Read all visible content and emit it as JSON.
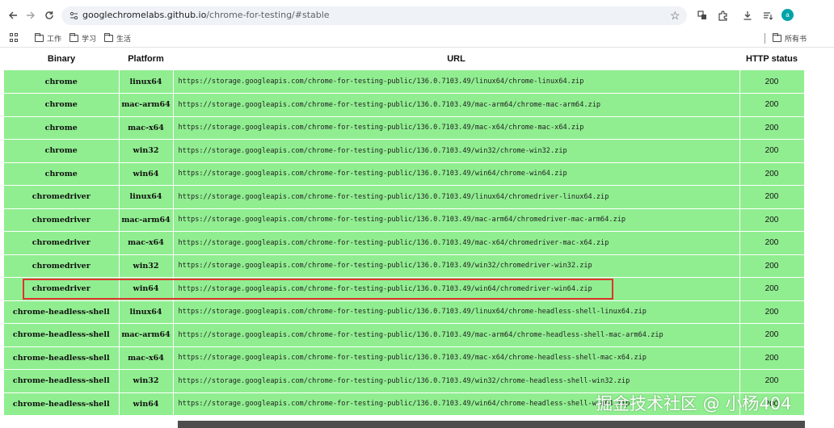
{
  "browser": {
    "url_host": "googlechromelabs.github.io",
    "url_path": "/chrome-for-testing/#stable",
    "avatar_letter": "a"
  },
  "bookmarks": {
    "items": [
      {
        "label": "工作"
      },
      {
        "label": "学习"
      },
      {
        "label": "生活"
      }
    ],
    "all_bookmarks_label": "所有书"
  },
  "table": {
    "headers": {
      "binary": "Binary",
      "platform": "Platform",
      "url": "URL",
      "status": "HTTP status"
    },
    "rows": [
      {
        "binary": "chrome",
        "platform": "linux64",
        "url": "https://storage.googleapis.com/chrome-for-testing-public/136.0.7103.49/linux64/chrome-linux64.zip",
        "status": "200"
      },
      {
        "binary": "chrome",
        "platform": "mac-arm64",
        "url": "https://storage.googleapis.com/chrome-for-testing-public/136.0.7103.49/mac-arm64/chrome-mac-arm64.zip",
        "status": "200"
      },
      {
        "binary": "chrome",
        "platform": "mac-x64",
        "url": "https://storage.googleapis.com/chrome-for-testing-public/136.0.7103.49/mac-x64/chrome-mac-x64.zip",
        "status": "200"
      },
      {
        "binary": "chrome",
        "platform": "win32",
        "url": "https://storage.googleapis.com/chrome-for-testing-public/136.0.7103.49/win32/chrome-win32.zip",
        "status": "200"
      },
      {
        "binary": "chrome",
        "platform": "win64",
        "url": "https://storage.googleapis.com/chrome-for-testing-public/136.0.7103.49/win64/chrome-win64.zip",
        "status": "200"
      },
      {
        "binary": "chromedriver",
        "platform": "linux64",
        "url": "https://storage.googleapis.com/chrome-for-testing-public/136.0.7103.49/linux64/chromedriver-linux64.zip",
        "status": "200"
      },
      {
        "binary": "chromedriver",
        "platform": "mac-arm64",
        "url": "https://storage.googleapis.com/chrome-for-testing-public/136.0.7103.49/mac-arm64/chromedriver-mac-arm64.zip",
        "status": "200"
      },
      {
        "binary": "chromedriver",
        "platform": "mac-x64",
        "url": "https://storage.googleapis.com/chrome-for-testing-public/136.0.7103.49/mac-x64/chromedriver-mac-x64.zip",
        "status": "200"
      },
      {
        "binary": "chromedriver",
        "platform": "win32",
        "url": "https://storage.googleapis.com/chrome-for-testing-public/136.0.7103.49/win32/chromedriver-win32.zip",
        "status": "200"
      },
      {
        "binary": "chromedriver",
        "platform": "win64",
        "url": "https://storage.googleapis.com/chrome-for-testing-public/136.0.7103.49/win64/chromedriver-win64.zip",
        "status": "200"
      },
      {
        "binary": "chrome-headless-shell",
        "platform": "linux64",
        "url": "https://storage.googleapis.com/chrome-for-testing-public/136.0.7103.49/linux64/chrome-headless-shell-linux64.zip",
        "status": "200"
      },
      {
        "binary": "chrome-headless-shell",
        "platform": "mac-arm64",
        "url": "https://storage.googleapis.com/chrome-for-testing-public/136.0.7103.49/mac-arm64/chrome-headless-shell-mac-arm64.zip",
        "status": "200"
      },
      {
        "binary": "chrome-headless-shell",
        "platform": "mac-x64",
        "url": "https://storage.googleapis.com/chrome-for-testing-public/136.0.7103.49/mac-x64/chrome-headless-shell-mac-x64.zip",
        "status": "200"
      },
      {
        "binary": "chrome-headless-shell",
        "platform": "win32",
        "url": "https://storage.googleapis.com/chrome-for-testing-public/136.0.7103.49/win32/chrome-headless-shell-win32.zip",
        "status": "200"
      },
      {
        "binary": "chrome-headless-shell",
        "platform": "win64",
        "url": "https://storage.googleapis.com/chrome-for-testing-public/136.0.7103.49/win64/chrome-headless-shell-win64.zip",
        "status": "200"
      }
    ],
    "row_color": "#90ee90",
    "highlight_color": "#e0342f"
  },
  "watermark": "掘金技术社区 @ 小杨404"
}
